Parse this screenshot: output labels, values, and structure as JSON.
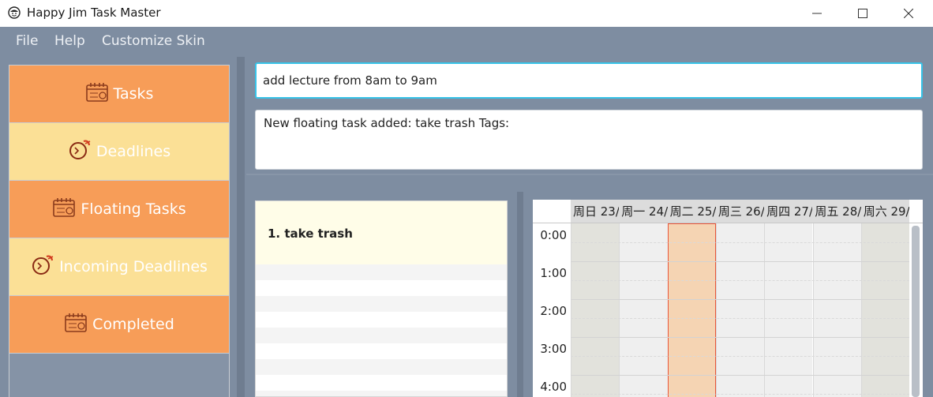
{
  "window": {
    "title": "Happy Jim Task Master",
    "icon": "smiley-icon",
    "controls": [
      "minimize-icon",
      "maximize-icon",
      "close-icon"
    ]
  },
  "menu": {
    "items": [
      "File",
      "Help",
      "Customize Skin"
    ]
  },
  "sidebar": {
    "items": [
      {
        "label": "Tasks",
        "icon": "calendar-icon",
        "color": "#f79d58"
      },
      {
        "label": "Deadlines",
        "icon": "alarm-clock-icon",
        "color": "#fbe096"
      },
      {
        "label": "Floating Tasks",
        "icon": "calendar-icon",
        "color": "#f79d58"
      },
      {
        "label": "Incoming Deadlines",
        "icon": "alarm-clock-icon",
        "color": "#fbe096"
      },
      {
        "label": "Completed",
        "icon": "calendar-icon",
        "color": "#f79d58"
      }
    ]
  },
  "command": {
    "value": "add lecture from 8am to 9am"
  },
  "result": {
    "text": "New floating task added: take trash Tags:"
  },
  "floating_list": {
    "items": [
      "1. take trash"
    ]
  },
  "calendar": {
    "days": [
      "周日 23/",
      "周一 24/",
      "周二 25/",
      "周三 26/",
      "周四 27/",
      "周五 28/",
      "周六 29/"
    ],
    "highlighted_day": "周二 25/",
    "times": [
      "0:00",
      "1:00",
      "2:00",
      "3:00",
      "4:00"
    ]
  },
  "colors": {
    "accent": "#37c3e8",
    "background": "#7e8da1",
    "today_border": "#e8553a"
  }
}
